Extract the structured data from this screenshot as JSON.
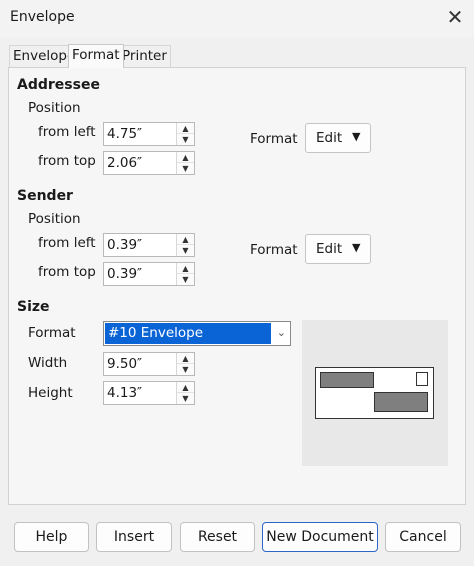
{
  "window": {
    "title": "Envelope",
    "close_glyph": "✕"
  },
  "tabs": [
    "Envelope",
    "Format",
    "Printer"
  ],
  "active_tab": "Format",
  "addressee": {
    "heading": "Addressee",
    "position_label": "Position",
    "from_left_label": "from left",
    "from_left_value": "4.75″",
    "from_top_label": "from top",
    "from_top_value": "2.06″",
    "format_label": "Format",
    "edit_label": "Edit"
  },
  "sender": {
    "heading": "Sender",
    "position_label": "Position",
    "from_left_label": "from left",
    "from_left_value": "0.39″",
    "from_top_label": "from top",
    "from_top_value": "0.39″",
    "format_label": "Format",
    "edit_label": "Edit"
  },
  "size": {
    "heading": "Size",
    "format_label": "Format",
    "format_value": "#10 Envelope",
    "width_label": "Width",
    "width_value": "9.50″",
    "height_label": "Height",
    "height_value": "4.13″"
  },
  "buttons": {
    "help": "Help",
    "insert": "Insert",
    "reset": "Reset",
    "new_document": "New Document",
    "cancel": "Cancel"
  },
  "colors": {
    "selection": "#0a64d6",
    "default_button_border": "#2a65c7"
  }
}
